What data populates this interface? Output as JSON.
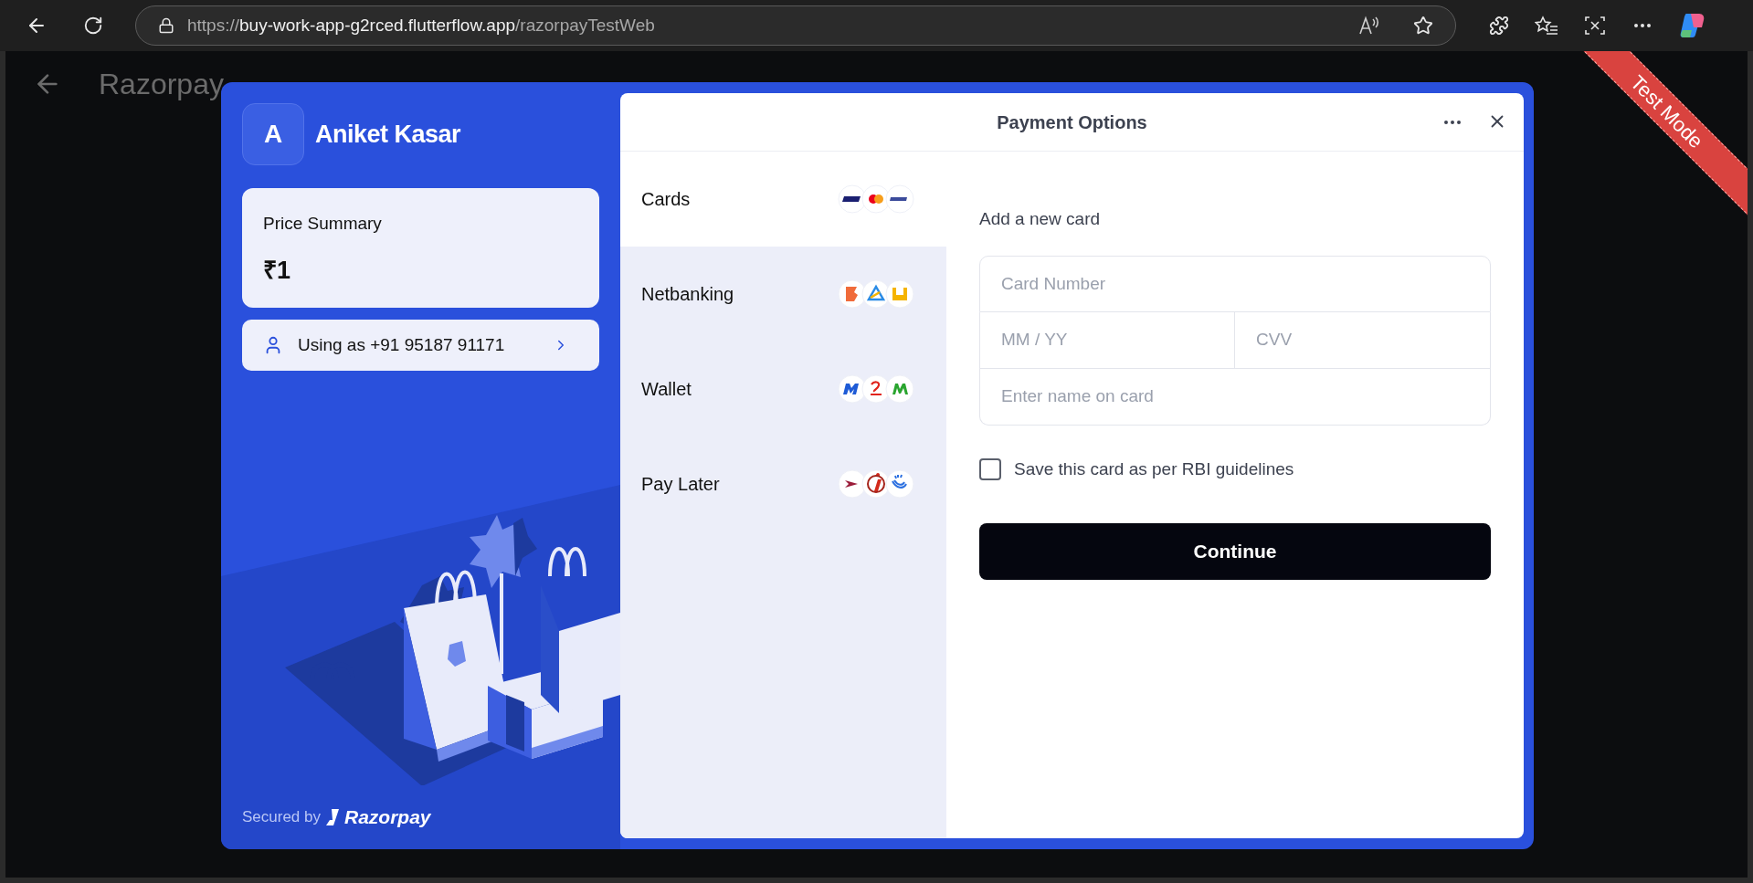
{
  "browser": {
    "url": {
      "scheme": "https://",
      "host": "buy-work-app-g2rced.flutterflow.app",
      "path": "/razorpayTestWeb"
    }
  },
  "app_bar": {
    "title": "Razorpay"
  },
  "ribbon": {
    "label": "Test Mode"
  },
  "checkout": {
    "merchant": {
      "initial": "A",
      "name": "Aniket Kasar"
    },
    "price_summary": {
      "label": "Price Summary",
      "amount": "₹1"
    },
    "user": {
      "text": "Using as +91 95187 91171"
    },
    "footer": {
      "secured_by": "Secured by",
      "brand": "Razorpay"
    },
    "header": {
      "title": "Payment Options"
    },
    "methods": [
      {
        "label": "Cards",
        "selected": true,
        "kind": "cards"
      },
      {
        "label": "Netbanking",
        "selected": false,
        "kind": "netbanking"
      },
      {
        "label": "Wallet",
        "selected": false,
        "kind": "wallet"
      },
      {
        "label": "Pay Later",
        "selected": false,
        "kind": "paylater"
      }
    ],
    "form": {
      "heading": "Add a new card",
      "card_number": {
        "placeholder": "Card Number"
      },
      "expiry": {
        "placeholder": "MM / YY"
      },
      "cvv": {
        "placeholder": "CVV"
      },
      "name": {
        "placeholder": "Enter name on card"
      },
      "save_card": {
        "label": "Save this card as per RBI guidelines",
        "checked": false
      },
      "continue": "Continue"
    }
  }
}
